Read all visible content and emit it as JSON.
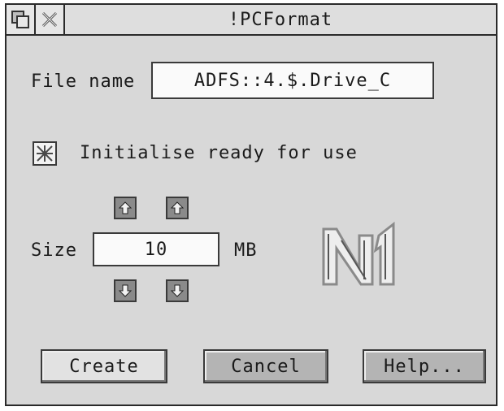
{
  "window": {
    "title": "!PCFormat"
  },
  "titlebar_icons": {
    "back": "back-icon",
    "close": "close-icon"
  },
  "file": {
    "label": "File name",
    "value": "ADFS::4.$.Drive_C"
  },
  "initialise": {
    "label": "Initialise ready for use",
    "checked": true
  },
  "size": {
    "label": "Size",
    "value": "10",
    "unit": "MB"
  },
  "buttons": {
    "create": "Create",
    "cancel": "Cancel",
    "help": "Help..."
  },
  "logo": {
    "icon": "logo-icon"
  }
}
